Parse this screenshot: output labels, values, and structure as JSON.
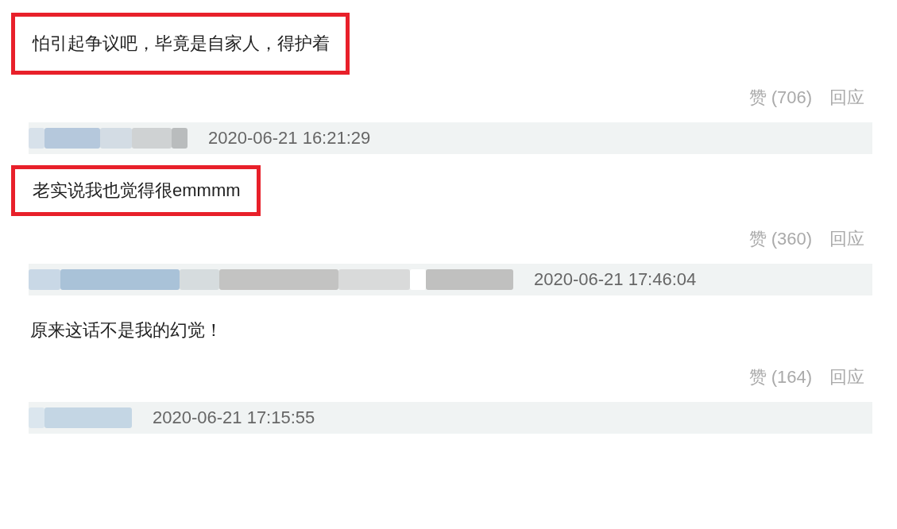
{
  "entries": [
    {
      "kind": "comment",
      "text": "怕引起争议吧，毕竟是自家人，得护着",
      "highlighted": true
    },
    {
      "kind": "actions",
      "likes": "赞 (706)",
      "reply": "回应"
    },
    {
      "kind": "header",
      "timestamp": "2020-06-21 16:21:29"
    },
    {
      "kind": "comment",
      "text": "老实说我也觉得很emmmm",
      "highlighted": true
    },
    {
      "kind": "actions",
      "likes": "赞 (360)",
      "reply": "回应"
    },
    {
      "kind": "header",
      "timestamp": "2020-06-21 17:46:04"
    },
    {
      "kind": "comment",
      "text": "原来这话不是我的幻觉！",
      "highlighted": false
    },
    {
      "kind": "actions",
      "likes": "赞 (164)",
      "reply": "回应"
    },
    {
      "kind": "header",
      "timestamp": "2020-06-21 17:15:55"
    }
  ]
}
